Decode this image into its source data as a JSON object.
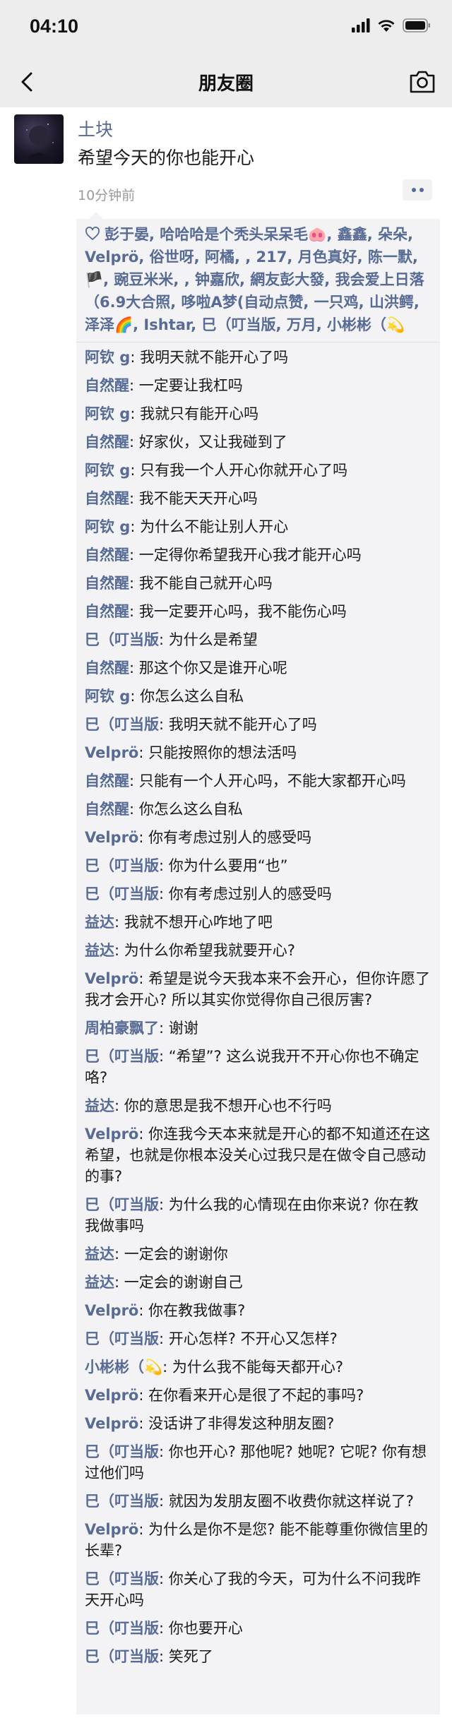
{
  "status_bar": {
    "time": "04:10"
  },
  "nav": {
    "title": "朋友圈"
  },
  "post": {
    "username": "土块",
    "text": "希望今天的你也能开心",
    "time": "10分钟前"
  },
  "likes": {
    "names": "彭于晏, 哈哈哈是个秃头呆呆毛🐽, 鑫鑫, 朵朵, Velprö, 俗世呀, 阿橘, , 217, 月色真好, 陈一默, 🏴, 豌豆米米, , 钟嘉欣, 網友彭大發, 我会爱上日落（6.9大合照, 哆啦A梦(自动点赞, 一只鸡, 山洪鳄, 泽泽🌈, Ishtar, 巳（叮当版, 万月, 小彬彬（💫"
  },
  "comments": [
    {
      "author": "阿钦 g",
      "text": "我明天就不能开心了吗"
    },
    {
      "author": "自然醒",
      "text": "一定要让我杠吗"
    },
    {
      "author": "阿钦 g",
      "text": "我就只有能开心吗"
    },
    {
      "author": "自然醒",
      "text": "好家伙，又让我碰到了"
    },
    {
      "author": "阿钦 g",
      "text": "只有我一个人开心你就开心了吗"
    },
    {
      "author": "自然醒",
      "text": "我不能天天开心吗"
    },
    {
      "author": "阿钦 g",
      "text": "为什么不能让别人开心"
    },
    {
      "author": "自然醒",
      "text": "一定得你希望我开心我才能开心吗"
    },
    {
      "author": "自然醒",
      "text": "我不能自己就开心吗"
    },
    {
      "author": "自然醒",
      "text": "我一定要开心吗，我不能伤心吗"
    },
    {
      "author": "巳（叮当版",
      "text": "为什么是希望"
    },
    {
      "author": "自然醒",
      "text": "那这个你又是谁开心呢"
    },
    {
      "author": "阿钦 g",
      "text": "你怎么这么自私"
    },
    {
      "author": "巳（叮当版",
      "text": "我明天就不能开心了吗"
    },
    {
      "author": "Velprö",
      "text": "只能按照你的想法活吗"
    },
    {
      "author": "自然醒",
      "text": "只能有一个人开心吗，不能大家都开心吗"
    },
    {
      "author": "自然醒",
      "text": "你怎么这么自私"
    },
    {
      "author": "Velprö",
      "text": "你有考虑过别人的感受吗"
    },
    {
      "author": "巳（叮当版",
      "text": "你为什么要用“也”"
    },
    {
      "author": "巳（叮当版",
      "text": "你有考虑过别人的感受吗"
    },
    {
      "author": "益达",
      "text": "我就不想开心咋地了吧"
    },
    {
      "author": "益达",
      "text": "为什么你希望我就要开心?"
    },
    {
      "author": "Velprö",
      "text": "希望是说今天我本来不会开心，但你许愿了我才会开心? 所以其实你觉得你自己很厉害?"
    },
    {
      "author": "周柏豪飘了",
      "text": "谢谢"
    },
    {
      "author": "巳（叮当版",
      "text": "“希望”? 这么说我开不开心你也不确定咯?"
    },
    {
      "author": "益达",
      "text": "你的意思是我不想开心也不行吗"
    },
    {
      "author": "Velprö",
      "text": "你连我今天本来就是开心的都不知道还在这希望，也就是你根本没关心过我只是在做令自己感动的事?"
    },
    {
      "author": "巳（叮当版",
      "text": "为什么我的心情现在由你来说? 你在教我做事吗"
    },
    {
      "author": "益达",
      "text": "一定会的谢谢你"
    },
    {
      "author": "益达",
      "text": "一定会的谢谢自己"
    },
    {
      "author": "Velprö",
      "text": "你在教我做事?"
    },
    {
      "author": "巳（叮当版",
      "text": "开心怎样? 不开心又怎样?"
    },
    {
      "author": "小彬彬（💫",
      "text": "为什么我不能每天都开心?"
    },
    {
      "author": "Velprö",
      "text": "在你看来开心是很了不起的事吗?"
    },
    {
      "author": "Velprö",
      "text": "没话讲了非得发这种朋友圈?"
    },
    {
      "author": "巳（叮当版",
      "text": "你也开心? 那他呢? 她呢? 它呢? 你有想过他们吗"
    },
    {
      "author": "巳（叮当版",
      "text": "就因为发朋友圈不收费你就这样说了?"
    },
    {
      "author": "Velprö",
      "text": "为什么是你不是您? 能不能尊重你微信里的长辈?"
    },
    {
      "author": "巳（叮当版",
      "text": "你关心了我的今天，可为什么不问我昨天开心吗"
    },
    {
      "author": "巳（叮当版",
      "text": "你也要开心"
    },
    {
      "author": "巳（叮当版",
      "text": "笑死了"
    }
  ],
  "colors": {
    "link": "#576b95",
    "nav_bg": "#ededed",
    "comment_bg": "#f3f3f5"
  },
  "icons": {
    "back": "chevron-left-icon",
    "camera": "camera-icon",
    "like": "heart-outline-icon",
    "more": "more-dots-icon"
  }
}
